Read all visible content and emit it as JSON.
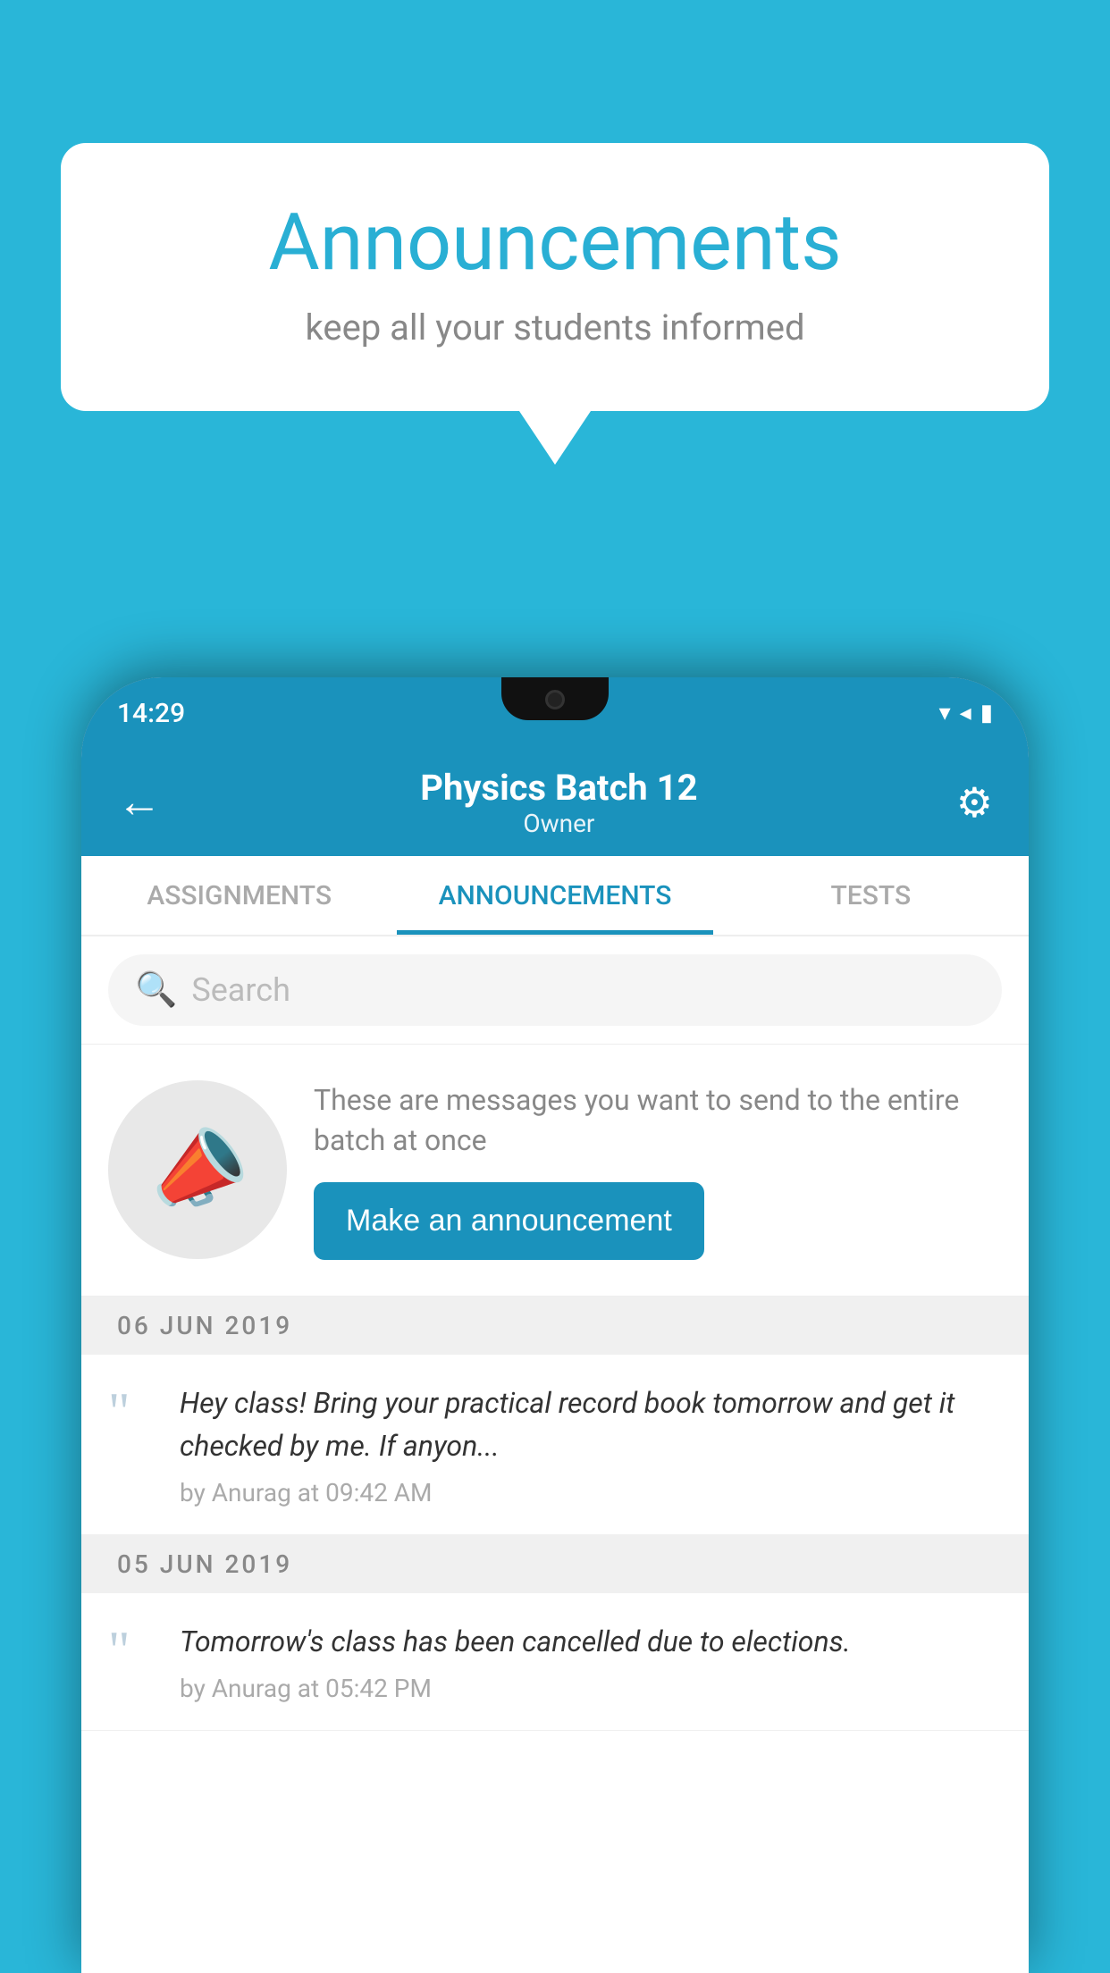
{
  "background_color": "#29b6d8",
  "speech_bubble": {
    "title": "Announcements",
    "subtitle": "keep all your students informed"
  },
  "phone": {
    "status_bar": {
      "time": "14:29",
      "icons": "▾◂▮"
    },
    "app_bar": {
      "title": "Physics Batch 12",
      "subtitle": "Owner",
      "back_label": "←",
      "settings_label": "⚙"
    },
    "tabs": [
      {
        "label": "ASSIGNMENTS",
        "active": false
      },
      {
        "label": "ANNOUNCEMENTS",
        "active": true
      },
      {
        "label": "TESTS",
        "active": false
      }
    ],
    "search": {
      "placeholder": "Search"
    },
    "announcement_prompt": {
      "description_text": "These are messages you want to send to the entire batch at once",
      "button_label": "Make an announcement"
    },
    "announcement_list": [
      {
        "date": "06  JUN  2019",
        "items": [
          {
            "text": "Hey class! Bring your practical record book tomorrow and get it checked by me. If anyon...",
            "meta": "by Anurag at 09:42 AM"
          }
        ]
      },
      {
        "date": "05  JUN  2019",
        "items": [
          {
            "text": "Tomorrow's class has been cancelled due to elections.",
            "meta": "by Anurag at 05:42 PM"
          }
        ]
      }
    ]
  }
}
